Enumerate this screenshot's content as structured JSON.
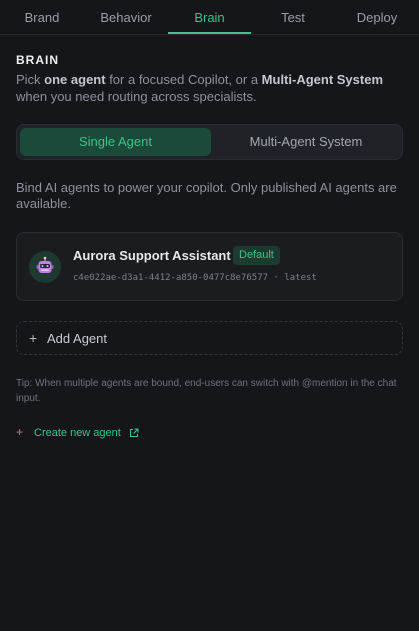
{
  "tabs": [
    {
      "label": "Brand"
    },
    {
      "label": "Behavior"
    },
    {
      "label": "Brain"
    },
    {
      "label": "Test"
    },
    {
      "label": "Deploy"
    }
  ],
  "active_tab": "Brain",
  "section": {
    "title": "BRAIN",
    "intro_pre": "Pick ",
    "intro_b1": "one agent",
    "intro_mid": " for a focused Copilot, or a ",
    "intro_b2": "Multi-Agent System",
    "intro_post": " when you need routing across specialists."
  },
  "mode": {
    "options": [
      "Single Agent",
      "Multi-Agent System"
    ],
    "selected": "Single Agent"
  },
  "bind_text": "Bind AI agents to power your copilot. Only published AI agents are available.",
  "agent": {
    "name": "Aurora Support Assistant",
    "badge": "Default",
    "meta": "c4e022ae-d3a1-4412-a850-0477c8e76577 · latest",
    "avatar_icon": "robot-icon"
  },
  "add_agent_label": "Add Agent",
  "tip": "Tip: When multiple agents are bound, end-users can switch with @mention in the chat input.",
  "create_link": "Create new agent",
  "colors": {
    "accent": "#3fc08c",
    "background": "#141619",
    "card": "#1a1c20"
  }
}
